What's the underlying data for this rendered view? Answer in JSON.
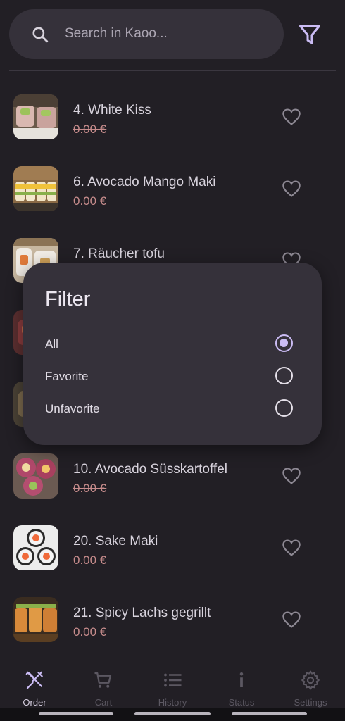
{
  "search": {
    "placeholder": "Search in Kaoo..."
  },
  "items": [
    {
      "name": "4. White Kiss",
      "price": "0.00 €"
    },
    {
      "name": "6. Avocado Mango Maki",
      "price": "0.00 €"
    },
    {
      "name": "7. Räucher tofu",
      "price": ""
    },
    {
      "name": "",
      "price": ""
    },
    {
      "name": "",
      "price": ""
    },
    {
      "name": "10. Avocado Süsskartoffel",
      "price": "0.00 €"
    },
    {
      "name": "20. Sake Maki",
      "price": "0.00 €"
    },
    {
      "name": "21. Spicy Lachs gegrillt",
      "price": "0.00 €"
    }
  ],
  "filter_dialog": {
    "title": "Filter",
    "options": [
      {
        "label": "All",
        "selected": true
      },
      {
        "label": "Favorite",
        "selected": false
      },
      {
        "label": "Unfavorite",
        "selected": false
      }
    ]
  },
  "nav": {
    "order": "Order",
    "cart": "Cart",
    "history": "History",
    "status": "Status",
    "settings": "Settings",
    "active": "order"
  },
  "colors": {
    "background": "#221f25",
    "surface": "#35313a",
    "accent": "#cbbcf4",
    "price_strike": "#c78c8c"
  }
}
